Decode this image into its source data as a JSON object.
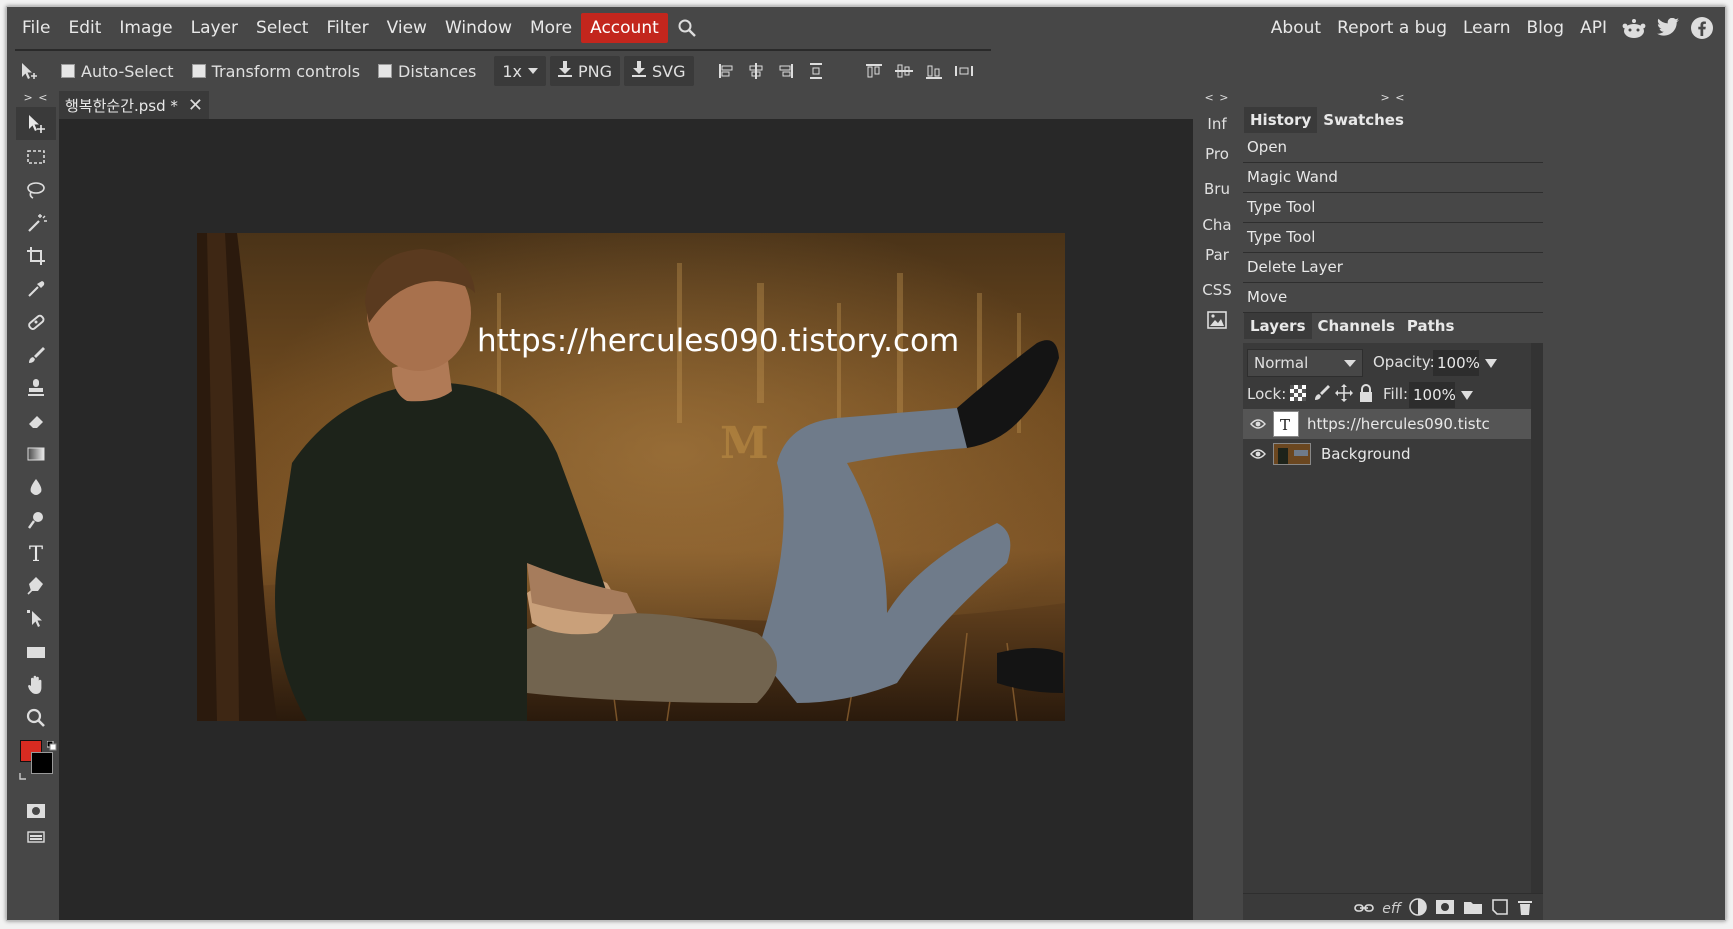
{
  "menu": {
    "items": [
      "File",
      "Edit",
      "Image",
      "Layer",
      "Select",
      "Filter",
      "View",
      "Window",
      "More"
    ],
    "account": "Account",
    "right_items": [
      "About",
      "Report a bug",
      "Learn",
      "Blog",
      "API"
    ],
    "accent_color": "#c3261d"
  },
  "options": {
    "auto_select": "Auto-Select",
    "transform_controls": "Transform controls",
    "distances": "Distances",
    "zoom": "1x",
    "png": "PNG",
    "svg": "SVG"
  },
  "toolbar": {
    "collapse": "> <",
    "tools": [
      "move-tool",
      "marquee-tool",
      "lasso-tool",
      "magic-wand-tool",
      "crop-tool",
      "eyedropper-tool",
      "healing-tool",
      "brush-tool",
      "stamp-tool",
      "eraser-tool",
      "gradient-tool",
      "blur-tool",
      "dodge-tool",
      "type-tool",
      "pen-tool",
      "path-select-tool",
      "shape-tool",
      "hand-tool",
      "zoom-tool"
    ],
    "foreground": "#d92b21",
    "background": "#000000"
  },
  "document": {
    "tab_title": "행복한순간.psd *",
    "close": "✕",
    "overlay_text": "https://hercules090.tistory.com"
  },
  "mini_panel": {
    "collapse": "< >",
    "items": [
      "Inf",
      "Pro",
      "Bru",
      "Cha",
      "Par",
      "CSS"
    ]
  },
  "history_panel": {
    "collapse": "> <",
    "tabs": [
      "History",
      "Swatches"
    ],
    "entries": [
      "Open",
      "Magic Wand",
      "Type Tool",
      "Type Tool",
      "Delete Layer",
      "Move"
    ]
  },
  "layers_panel": {
    "tabs": [
      "Layers",
      "Channels",
      "Paths"
    ],
    "blend_mode": "Normal",
    "opacity_label": "Opacity:",
    "opacity": "100%",
    "lock_label": "Lock:",
    "fill_label": "Fill:",
    "fill": "100%",
    "layers": [
      {
        "name": "https://hercules090.tistc",
        "type": "text",
        "selected": true
      },
      {
        "name": "Background",
        "type": "image",
        "selected": false
      }
    ],
    "footer_eff": "eff"
  }
}
